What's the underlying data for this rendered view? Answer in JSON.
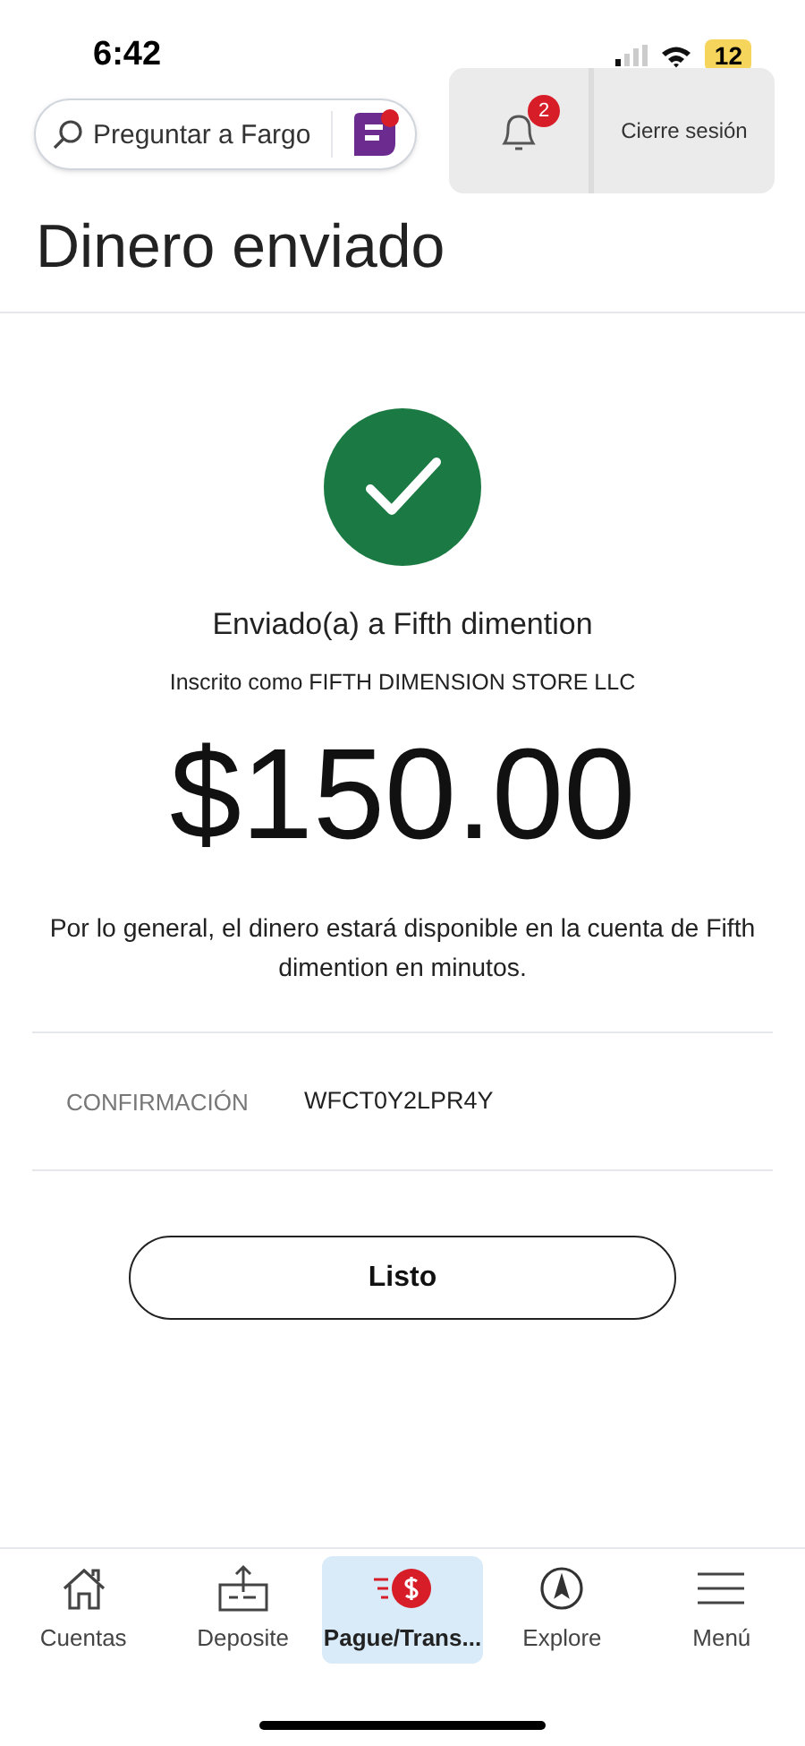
{
  "status_bar": {
    "time": "6:42",
    "battery": "12"
  },
  "header": {
    "search": {
      "placeholder": "Preguntar a Fargo"
    },
    "notifications": {
      "count": "2"
    },
    "logout": "Cierre sesión"
  },
  "title": "Dinero enviado",
  "confirmation": {
    "recipient": "Enviado(a) a Fifth dimention",
    "enrolled_as": "Inscrito como FIFTH DIMENSION STORE LLC",
    "amount": "$150.00",
    "note": "Por lo general, el dinero estará disponible en la cuenta de Fifth dimention en minutos.",
    "label": "CONFIRMACIÓN",
    "code": "WFCT0Y2LPR4Y",
    "button": "Listo"
  },
  "nav": [
    {
      "kind": "home",
      "label": "Cuentas",
      "selected": false
    },
    {
      "kind": "deposit",
      "label": "Deposite",
      "selected": false
    },
    {
      "kind": "pay",
      "label": "Pague/Trans...",
      "selected": true
    },
    {
      "kind": "explore",
      "label": "Explore",
      "selected": false
    },
    {
      "kind": "menu",
      "label": "Menú",
      "selected": false
    }
  ]
}
